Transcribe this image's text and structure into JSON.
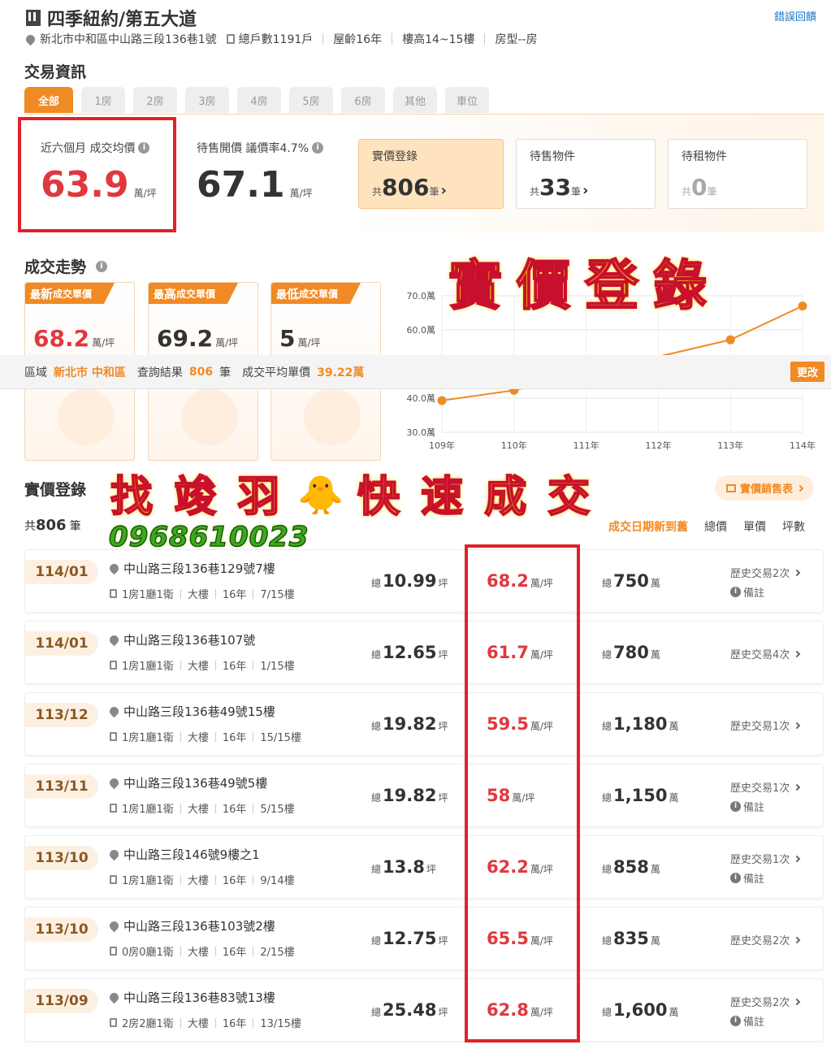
{
  "header": {
    "title": "四季紐約/第五大道",
    "report_link": "錯誤回饋",
    "address": "新北市中和區中山路三段136巷1號",
    "households": "總戶數1191戶",
    "age": "屋齡16年",
    "floors": "樓高14~15樓",
    "room_type": "房型--房"
  },
  "transaction_info": {
    "title": "交易資訊",
    "tabs": [
      "全部",
      "1房",
      "2房",
      "3房",
      "4房",
      "5房",
      "6房",
      "其他",
      "車位"
    ],
    "avg_label": "近六個月 成交均價",
    "avg_value": "63.9",
    "unit": "萬/坪",
    "ask_label": "待售開價 議價率4.7%",
    "ask_value": "67.1",
    "cards": [
      {
        "title": "實價登錄",
        "prefix": "共",
        "count": "806",
        "suffix": "筆",
        "arrow": "›"
      },
      {
        "title": "待售物件",
        "prefix": "共",
        "count": "33",
        "suffix": "筆",
        "arrow": "›"
      },
      {
        "title": "待租物件",
        "prefix": "共",
        "count": "0",
        "suffix": "筆",
        "arrow": ""
      }
    ]
  },
  "trend": {
    "title": "成交走勢",
    "cards": [
      {
        "lead": "最",
        "label_big": "新",
        "label_rest": "成交單價",
        "value": "68.2",
        "unit": "萬/坪"
      },
      {
        "lead": "最",
        "label_big": "高",
        "label_rest": "成交單價",
        "value": "69.2",
        "unit": "萬/坪"
      },
      {
        "lead": "最",
        "label_big": "低",
        "label_rest": "成交單價",
        "value": "5",
        "unit": "萬/坪"
      }
    ]
  },
  "chart_data": {
    "type": "line",
    "categories": [
      "109年",
      "110年",
      "111年",
      "112年",
      "113年",
      "114年"
    ],
    "y_tick_labels": [
      "30.0萬",
      "40.0萬",
      "50.0萬",
      "60.0萬",
      "70.0萬"
    ],
    "ylim": [
      30,
      70
    ],
    "series": [
      {
        "values": [
          39.3,
          42.3,
          null,
          null,
          57.1,
          67.0
        ],
        "color": "#f08a24"
      }
    ],
    "grid": true
  },
  "filter_bar": {
    "region_label": "區域",
    "region_value": "新北市 中和區",
    "result_label": "查詢結果",
    "result_value": "806",
    "result_unit": "筆",
    "avg_label": "成交平均單價",
    "avg_value": "39.22萬",
    "change_btn": "更改"
  },
  "watermarks": {
    "main": "實價登錄",
    "promo_1": "找 竣 羽",
    "promo_2": "快 速 成 交",
    "chick": "🐥",
    "phone": "0968610023"
  },
  "listing": {
    "title": "實價登錄",
    "count_prefix": "共",
    "count": "806",
    "count_suffix": "筆",
    "sales_btn": "實價銷售表",
    "sort": [
      "成交日期新到舊",
      "總價",
      "單價",
      "坪數"
    ],
    "area_prefix": "總",
    "area_unit": "坪",
    "price_unit": "萬/坪",
    "total_prefix": "總",
    "total_unit": "萬",
    "note_label": "備註",
    "rows": [
      {
        "date": "114/01",
        "addr": "中山路三段136巷129號7樓",
        "layout": "1房1廳1衛",
        "type": "大樓",
        "age": "16年",
        "floor": "7/15樓",
        "area": "10.99",
        "price": "68.2",
        "total": "750",
        "history": "歷史交易2次",
        "note": true
      },
      {
        "date": "114/01",
        "addr": "中山路三段136巷107號",
        "layout": "1房1廳1衛",
        "type": "大樓",
        "age": "16年",
        "floor": "1/15樓",
        "area": "12.65",
        "price": "61.7",
        "total": "780",
        "history": "歷史交易4次",
        "note": false
      },
      {
        "date": "113/12",
        "addr": "中山路三段136巷49號15樓",
        "layout": "1房1廳1衛",
        "type": "大樓",
        "age": "16年",
        "floor": "15/15樓",
        "area": "19.82",
        "price": "59.5",
        "total": "1,180",
        "history": "歷史交易1次",
        "note": false
      },
      {
        "date": "113/11",
        "addr": "中山路三段136巷49號5樓",
        "layout": "1房1廳1衛",
        "type": "大樓",
        "age": "16年",
        "floor": "5/15樓",
        "area": "19.82",
        "price": "58",
        "total": "1,150",
        "history": "歷史交易1次",
        "note": true
      },
      {
        "date": "113/10",
        "addr": "中山路三段146號9樓之1",
        "layout": "1房1廳1衛",
        "type": "大樓",
        "age": "16年",
        "floor": "9/14樓",
        "area": "13.8",
        "price": "62.2",
        "total": "858",
        "history": "歷史交易1次",
        "note": true
      },
      {
        "date": "113/10",
        "addr": "中山路三段136巷103號2樓",
        "layout": "0房0廳1衛",
        "type": "大樓",
        "age": "16年",
        "floor": "2/15樓",
        "area": "12.75",
        "price": "65.5",
        "total": "835",
        "history": "歷史交易2次",
        "note": false
      },
      {
        "date": "113/09",
        "addr": "中山路三段136巷83號13樓",
        "layout": "2房2廳1衛",
        "type": "大樓",
        "age": "16年",
        "floor": "13/15樓",
        "area": "25.48",
        "price": "62.8",
        "total": "1,600",
        "history": "歷史交易2次",
        "note": true
      }
    ]
  }
}
